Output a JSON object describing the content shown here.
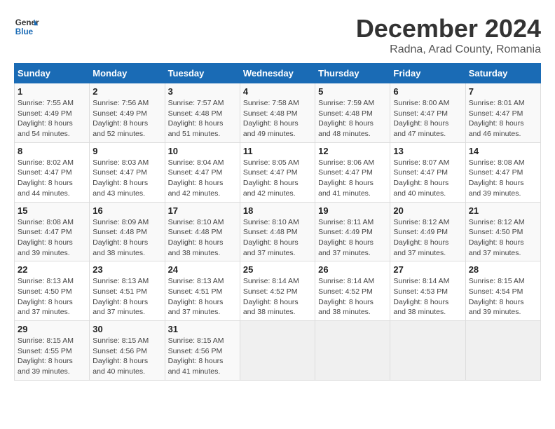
{
  "logo": {
    "line1": "General",
    "line2": "Blue"
  },
  "title": "December 2024",
  "subtitle": "Radna, Arad County, Romania",
  "days_header": [
    "Sunday",
    "Monday",
    "Tuesday",
    "Wednesday",
    "Thursday",
    "Friday",
    "Saturday"
  ],
  "weeks": [
    [
      {
        "day": "1",
        "info": "Sunrise: 7:55 AM\nSunset: 4:49 PM\nDaylight: 8 hours\nand 54 minutes."
      },
      {
        "day": "2",
        "info": "Sunrise: 7:56 AM\nSunset: 4:49 PM\nDaylight: 8 hours\nand 52 minutes."
      },
      {
        "day": "3",
        "info": "Sunrise: 7:57 AM\nSunset: 4:48 PM\nDaylight: 8 hours\nand 51 minutes."
      },
      {
        "day": "4",
        "info": "Sunrise: 7:58 AM\nSunset: 4:48 PM\nDaylight: 8 hours\nand 49 minutes."
      },
      {
        "day": "5",
        "info": "Sunrise: 7:59 AM\nSunset: 4:48 PM\nDaylight: 8 hours\nand 48 minutes."
      },
      {
        "day": "6",
        "info": "Sunrise: 8:00 AM\nSunset: 4:47 PM\nDaylight: 8 hours\nand 47 minutes."
      },
      {
        "day": "7",
        "info": "Sunrise: 8:01 AM\nSunset: 4:47 PM\nDaylight: 8 hours\nand 46 minutes."
      }
    ],
    [
      {
        "day": "8",
        "info": "Sunrise: 8:02 AM\nSunset: 4:47 PM\nDaylight: 8 hours\nand 44 minutes."
      },
      {
        "day": "9",
        "info": "Sunrise: 8:03 AM\nSunset: 4:47 PM\nDaylight: 8 hours\nand 43 minutes."
      },
      {
        "day": "10",
        "info": "Sunrise: 8:04 AM\nSunset: 4:47 PM\nDaylight: 8 hours\nand 42 minutes."
      },
      {
        "day": "11",
        "info": "Sunrise: 8:05 AM\nSunset: 4:47 PM\nDaylight: 8 hours\nand 42 minutes."
      },
      {
        "day": "12",
        "info": "Sunrise: 8:06 AM\nSunset: 4:47 PM\nDaylight: 8 hours\nand 41 minutes."
      },
      {
        "day": "13",
        "info": "Sunrise: 8:07 AM\nSunset: 4:47 PM\nDaylight: 8 hours\nand 40 minutes."
      },
      {
        "day": "14",
        "info": "Sunrise: 8:08 AM\nSunset: 4:47 PM\nDaylight: 8 hours\nand 39 minutes."
      }
    ],
    [
      {
        "day": "15",
        "info": "Sunrise: 8:08 AM\nSunset: 4:47 PM\nDaylight: 8 hours\nand 39 minutes."
      },
      {
        "day": "16",
        "info": "Sunrise: 8:09 AM\nSunset: 4:48 PM\nDaylight: 8 hours\nand 38 minutes."
      },
      {
        "day": "17",
        "info": "Sunrise: 8:10 AM\nSunset: 4:48 PM\nDaylight: 8 hours\nand 38 minutes."
      },
      {
        "day": "18",
        "info": "Sunrise: 8:10 AM\nSunset: 4:48 PM\nDaylight: 8 hours\nand 37 minutes."
      },
      {
        "day": "19",
        "info": "Sunrise: 8:11 AM\nSunset: 4:49 PM\nDaylight: 8 hours\nand 37 minutes."
      },
      {
        "day": "20",
        "info": "Sunrise: 8:12 AM\nSunset: 4:49 PM\nDaylight: 8 hours\nand 37 minutes."
      },
      {
        "day": "21",
        "info": "Sunrise: 8:12 AM\nSunset: 4:50 PM\nDaylight: 8 hours\nand 37 minutes."
      }
    ],
    [
      {
        "day": "22",
        "info": "Sunrise: 8:13 AM\nSunset: 4:50 PM\nDaylight: 8 hours\nand 37 minutes."
      },
      {
        "day": "23",
        "info": "Sunrise: 8:13 AM\nSunset: 4:51 PM\nDaylight: 8 hours\nand 37 minutes."
      },
      {
        "day": "24",
        "info": "Sunrise: 8:13 AM\nSunset: 4:51 PM\nDaylight: 8 hours\nand 37 minutes."
      },
      {
        "day": "25",
        "info": "Sunrise: 8:14 AM\nSunset: 4:52 PM\nDaylight: 8 hours\nand 38 minutes."
      },
      {
        "day": "26",
        "info": "Sunrise: 8:14 AM\nSunset: 4:52 PM\nDaylight: 8 hours\nand 38 minutes."
      },
      {
        "day": "27",
        "info": "Sunrise: 8:14 AM\nSunset: 4:53 PM\nDaylight: 8 hours\nand 38 minutes."
      },
      {
        "day": "28",
        "info": "Sunrise: 8:15 AM\nSunset: 4:54 PM\nDaylight: 8 hours\nand 39 minutes."
      }
    ],
    [
      {
        "day": "29",
        "info": "Sunrise: 8:15 AM\nSunset: 4:55 PM\nDaylight: 8 hours\nand 39 minutes."
      },
      {
        "day": "30",
        "info": "Sunrise: 8:15 AM\nSunset: 4:56 PM\nDaylight: 8 hours\nand 40 minutes."
      },
      {
        "day": "31",
        "info": "Sunrise: 8:15 AM\nSunset: 4:56 PM\nDaylight: 8 hours\nand 41 minutes."
      },
      {
        "day": "",
        "info": ""
      },
      {
        "day": "",
        "info": ""
      },
      {
        "day": "",
        "info": ""
      },
      {
        "day": "",
        "info": ""
      }
    ]
  ]
}
